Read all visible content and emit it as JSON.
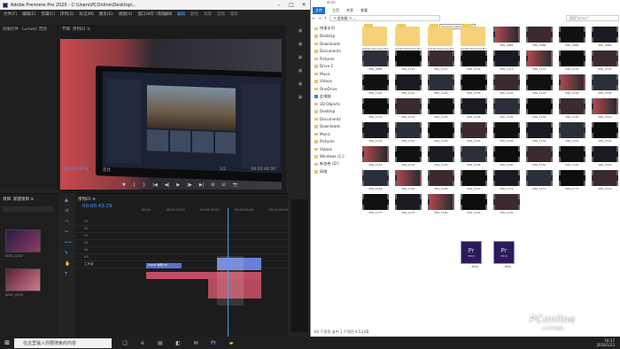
{
  "premiere": {
    "title": "Adobe Premiere Pro 2020 - C:\\Users\\PCOnline\\Desktop\\...",
    "menu": [
      "文件(F)",
      "编辑(E)",
      "剪辑(C)",
      "序列(S)",
      "标记(M)",
      "图形(G)",
      "视图(V)",
      "窗口(W)",
      "帮助(H)"
    ],
    "workspaces": [
      "学习",
      "组件",
      "编辑",
      "颜色",
      "效果",
      "音频",
      "图形"
    ],
    "source_tabs": [
      "效果控件",
      "Lumetri 范围"
    ],
    "monitor_tab": "节目: 序列01 ≡",
    "timecode": "00:00:43:29",
    "fit": "适合",
    "fraction": "1/2",
    "duration": "00:02:44:00",
    "transport": [
      "▼",
      "{",
      "}",
      "|◀",
      "◀|",
      "▶",
      "|▶",
      "▶|",
      "⊞",
      "⊟",
      "📷"
    ],
    "project_tab": "项目: 新建项目 ≡",
    "timeline_tab": "序列01 ≡",
    "timeline_tc": "00:00:43:29",
    "ruler": [
      "00:00",
      "00:00:15:00",
      "00:00:30:00",
      "00:00:45:00",
      "00:01:00:00"
    ],
    "clip_label": "C0001 效果 [V]",
    "tracks": [
      "V3",
      "V2",
      "V1",
      "A1",
      "A2",
      "A3",
      "主声道"
    ],
    "clips": [
      "A001_C002",
      "A001_C004"
    ]
  },
  "explorer": {
    "title": "dcim",
    "ribbon": [
      "文件",
      "主页",
      "共享",
      "查看"
    ],
    "address": "> 此电脑 > ...",
    "search_placeholder": "搜索\"pcsrc\"",
    "tooltip": "Formula Cascade: 2021",
    "nav": [
      {
        "label": "快速访问",
        "type": "star"
      },
      {
        "label": "Desktop",
        "type": "folder"
      },
      {
        "label": "Downloads",
        "type": "folder"
      },
      {
        "label": "Documents",
        "type": "folder"
      },
      {
        "label": "Pictures",
        "type": "folder"
      },
      {
        "label": "Drive 1",
        "type": "folder"
      },
      {
        "label": "Music",
        "type": "folder"
      },
      {
        "label": "Videos",
        "type": "folder"
      },
      {
        "label": "OneDrive",
        "type": "cloud"
      },
      {
        "label": "此电脑",
        "type": "pc"
      },
      {
        "label": "3D Objects",
        "type": "folder"
      },
      {
        "label": "Desktop",
        "type": "folder"
      },
      {
        "label": "Documents",
        "type": "folder"
      },
      {
        "label": "Downloads",
        "type": "folder"
      },
      {
        "label": "Music",
        "type": "folder"
      },
      {
        "label": "Pictures",
        "type": "folder"
      },
      {
        "label": "Videos",
        "type": "folder"
      },
      {
        "label": "Windows (C:)",
        "type": "drive"
      },
      {
        "label": "新加卷 (D:)",
        "type": "drive"
      },
      {
        "label": "网络",
        "type": "net"
      }
    ],
    "folders": [
      "Adobe Premiere Pro Audio Previews",
      "Adobe Premiere Pro Auto-Save",
      "Adobe Premiere Pro Captured Audio",
      "Adobe Premiere Pro Captured Video"
    ],
    "files": [
      "IMG_0085",
      "IMG_0086",
      "IMG_0082",
      "IMG_0090",
      "IMG_0086",
      "IMG_1110",
      "IMG_1111",
      "IMG_1112",
      "IMG_1113",
      "IMG_1114",
      "IMG_1115",
      "IMG_1116",
      "IMG_1120",
      "IMG_1121",
      "IMG_1122",
      "IMG_1123",
      "IMG_1124",
      "IMG_1125",
      "IMG_1126",
      "IMG_1130",
      "IMG_1131",
      "IMG_1132",
      "IMG_1133",
      "IMG_1134",
      "IMG_1135",
      "IMG_1136",
      "IMG_1140",
      "IMG_1141",
      "IMG_1142",
      "IMG_1143",
      "IMG_1144",
      "IMG_1145",
      "IMG_1146",
      "IMG_1150",
      "IMG_1151",
      "IMG_1152",
      "IMG_1153",
      "IMG_1154",
      "IMG_1155",
      "IMG_1156",
      "IMG_1160",
      "IMG_1161",
      "IMG_1162",
      "IMG_1163",
      "IMG_1164",
      "IMG_1165",
      "IMG_1166",
      "IMG_1170",
      "IMG_1171",
      "IMG_1172",
      "IMG_1173",
      "IMG_1174",
      "IMG_1175",
      "IMG_1176",
      "IMG_1180",
      "IMG_1181",
      "IMG_1182"
    ],
    "projects": [
      "...PROJ",
      "...PROJ"
    ],
    "status": "64 个项目  选中 1 个项目  4.53 KB"
  },
  "taskbar": {
    "search": "在这里输入你要搜索的内容",
    "clock_time": "16:17",
    "clock_date": "2020/1/23"
  },
  "watermark": {
    "logo": "PConline",
    "sub": "太平洋电脑网"
  }
}
